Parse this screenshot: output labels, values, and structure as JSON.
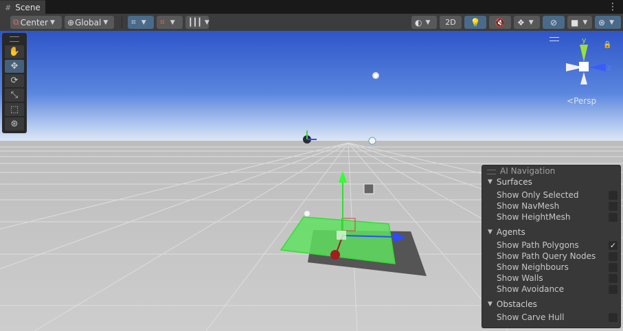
{
  "tab": {
    "label": "Scene",
    "icon": "grid-icon"
  },
  "toolbar": {
    "pivot": "Center",
    "space": "Global",
    "mode_2d": "2D"
  },
  "tools": [
    "hand-icon",
    "move-icon",
    "rotate-icon",
    "scale-icon",
    "rect-icon",
    "transform-icon"
  ],
  "gizmo": {
    "y": "y",
    "z": "z",
    "projection": "Persp"
  },
  "ai_navigation": {
    "title": "AI Navigation",
    "sections": [
      {
        "name": "Surfaces",
        "items": [
          {
            "label": "Show Only Selected",
            "checked": false
          },
          {
            "label": "Show NavMesh",
            "checked": false
          },
          {
            "label": "Show HeightMesh",
            "checked": false
          }
        ]
      },
      {
        "name": "Agents",
        "items": [
          {
            "label": "Show Path Polygons",
            "checked": true
          },
          {
            "label": "Show Path Query Nodes",
            "checked": false
          },
          {
            "label": "Show Neighbours",
            "checked": false
          },
          {
            "label": "Show Walls",
            "checked": false
          },
          {
            "label": "Show Avoidance",
            "checked": false
          }
        ]
      },
      {
        "name": "Obstacles",
        "items": [
          {
            "label": "Show Carve Hull",
            "checked": false
          }
        ]
      }
    ]
  },
  "colors": {
    "sky_top": "#2f55c9",
    "horizon": "#dfe8f5",
    "ground": "#cfcfcf",
    "gizmo_green": "#33dd33",
    "gizmo_blue": "#2d4bff",
    "gizmo_red": "#a31e1e"
  }
}
